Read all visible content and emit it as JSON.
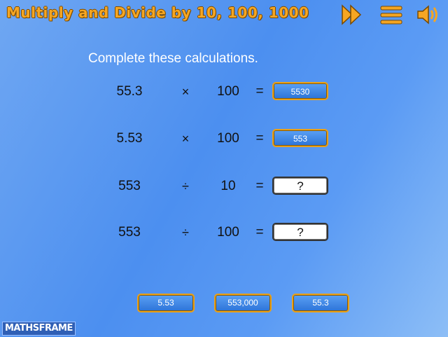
{
  "header": {
    "title": "Multiply and Divide by 10, 100, 1000",
    "icons": [
      "fast-forward-icon",
      "menu-icon",
      "speaker-icon"
    ],
    "accent_color": "#f5a623"
  },
  "instruction": "Complete these calculations.",
  "calculations": [
    {
      "left": "55.3",
      "operator": "×",
      "right": "100",
      "equals": "=",
      "answer": "5530",
      "state": "filled"
    },
    {
      "left": "5.53",
      "operator": "×",
      "right": "100",
      "equals": "=",
      "answer": "553",
      "state": "filled"
    },
    {
      "left": "553",
      "operator": "÷",
      "right": "10",
      "equals": "=",
      "answer": "?",
      "state": "empty"
    },
    {
      "left": "553",
      "operator": "÷",
      "right": "100",
      "equals": "=",
      "answer": "?",
      "state": "empty"
    }
  ],
  "choices": [
    "5.53",
    "553,000",
    "55.3"
  ],
  "logo": "MATHSFRAME"
}
